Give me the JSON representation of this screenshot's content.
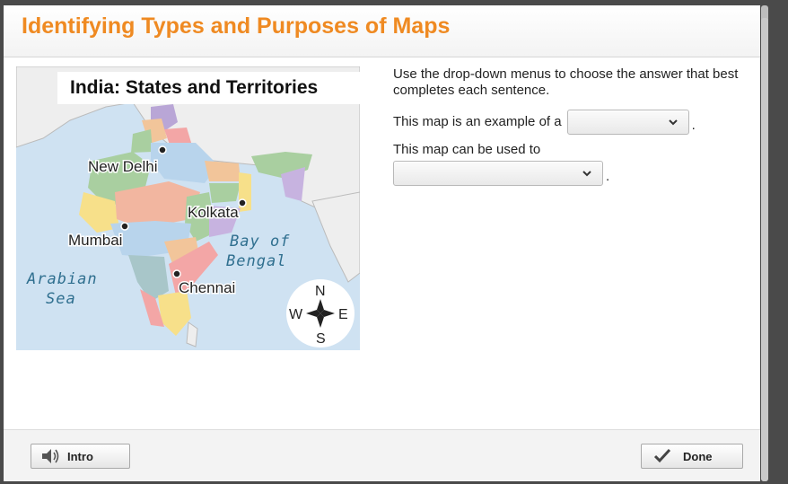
{
  "header": {
    "title": "Identifying Types and Purposes of Maps"
  },
  "map": {
    "title": "India: States and Territories",
    "labels": {
      "new_delhi": "New Delhi",
      "kolkata": "Kolkata",
      "mumbai": "Mumbai",
      "chennai": "Chennai",
      "bay_of_bengal_line1": "Bay of",
      "bay_of_bengal_line2": "Bengal",
      "arabian_sea_line1": "Arabian",
      "arabian_sea_line2": "Sea"
    },
    "compass": {
      "north": "N",
      "south": "S",
      "east": "E",
      "west": "W"
    }
  },
  "question": {
    "instructions": "Use the drop-down menus to choose the answer that best completes each sentence.",
    "sentence1": "This map is an example of a",
    "sentence1_end": ".",
    "dropdown1_value": "",
    "sentence2": "This map can be used to",
    "sentence2_end": ".",
    "dropdown2_value": ""
  },
  "footer": {
    "intro_label": "Intro",
    "done_label": "Done"
  },
  "icons": {
    "intro": "speaker-icon",
    "done": "checkmark-icon",
    "dropdown": "chevron-down-icon",
    "compass": "compass-rose-icon"
  },
  "colors": {
    "title": "#ef8a22",
    "water": "#cfe2f2",
    "land_other": "#eeeeee"
  }
}
